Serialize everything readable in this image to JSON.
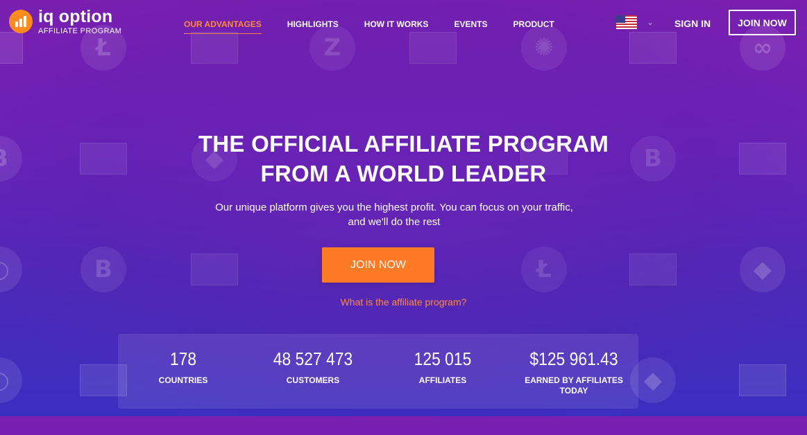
{
  "brand": {
    "name": "iq option",
    "subtitle": "AFFILIATE PROGRAM"
  },
  "nav": {
    "items": [
      {
        "label": "OUR ADVANTAGES",
        "active": true
      },
      {
        "label": "HIGHLIGHTS",
        "active": false
      },
      {
        "label": "HOW IT WORKS",
        "active": false
      },
      {
        "label": "EVENTS",
        "active": false
      },
      {
        "label": "PRODUCT",
        "active": false
      }
    ],
    "language_icon": "us-flag-icon",
    "sign_in": "SIGN IN",
    "join_now": "JOIN NOW"
  },
  "hero": {
    "title_line1": "THE OFFICIAL AFFILIATE PROGRAM",
    "title_line2": "FROM A WORLD LEADER",
    "subtitle_line1": "Our unique platform gives you the highest profit. You can focus on your traffic,",
    "subtitle_line2": "and we'll do the rest",
    "cta": "JOIN NOW",
    "link": "What is the affiliate program?"
  },
  "stats": [
    {
      "value": "178",
      "label": "COUNTRIES"
    },
    {
      "value": "48 527 473",
      "label": "CUSTOMERS"
    },
    {
      "value": "125 015",
      "label": "AFFILIATES"
    },
    {
      "value": "$125 961.43",
      "label": "EARNED BY AFFILIATES TODAY"
    }
  ],
  "colors": {
    "accent": "#ff7a24",
    "active_nav": "#ff8a3d",
    "background_top": "#7a1fb0",
    "background_bottom": "#3a2ec0"
  }
}
